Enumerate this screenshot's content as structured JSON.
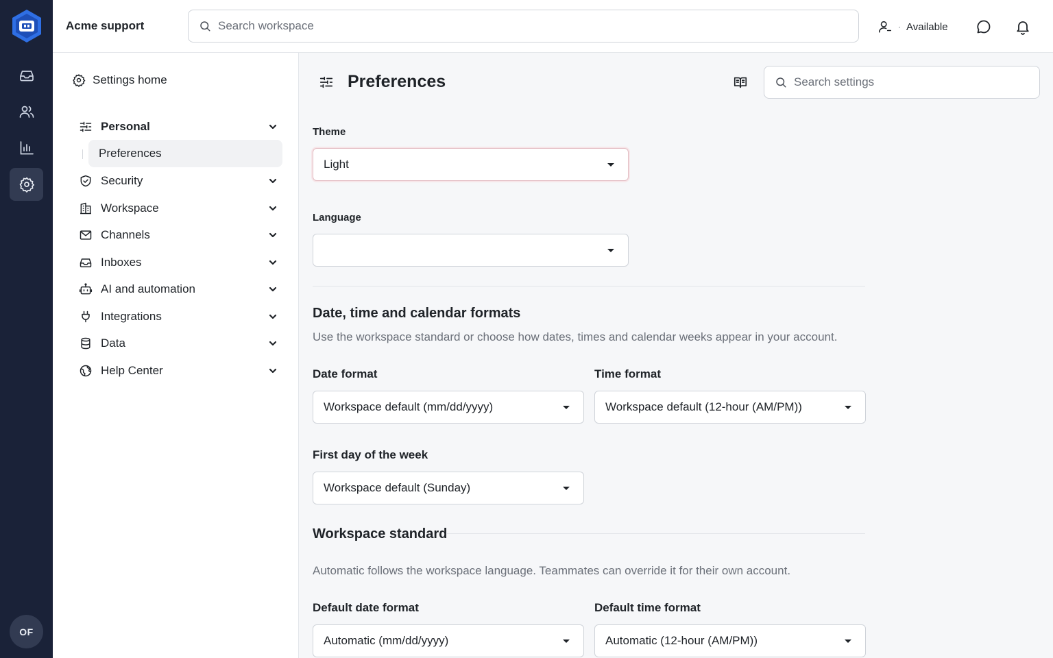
{
  "app": {
    "workspace_name": "Acme support"
  },
  "header": {
    "search_placeholder": "Search workspace",
    "status": "Available",
    "status_dot": "·"
  },
  "rail": {
    "items": [
      {
        "icon": "inbox-icon"
      },
      {
        "icon": "users-icon"
      },
      {
        "icon": "reports-icon"
      },
      {
        "icon": "settings-icon",
        "active": true
      }
    ],
    "avatar_initials": "OF"
  },
  "sidebar": {
    "home_label": "Settings home",
    "items": [
      {
        "label": "Personal",
        "icon": "sliders-icon",
        "expanded": true
      },
      {
        "label": "Security",
        "icon": "shield-icon"
      },
      {
        "label": "Workspace",
        "icon": "building-icon"
      },
      {
        "label": "Channels",
        "icon": "mail-icon"
      },
      {
        "label": "Inboxes",
        "icon": "inbox-icon"
      },
      {
        "label": "AI and automation",
        "icon": "bot-icon"
      },
      {
        "label": "Integrations",
        "icon": "plug-icon"
      },
      {
        "label": "Data",
        "icon": "database-icon"
      },
      {
        "label": "Help Center",
        "icon": "globe-icon"
      }
    ],
    "sub_item": "Preferences"
  },
  "main": {
    "title": "Preferences",
    "search_placeholder": "Search settings",
    "theme": {
      "label": "Theme",
      "value": "Light"
    },
    "language": {
      "label": "Language",
      "value": ""
    },
    "date_section": {
      "title": "Date, time and calendar formats",
      "description": "Use the workspace standard or choose how dates, times and calendar weeks appear in your account."
    },
    "date_format": {
      "label": "Date format",
      "value": "Workspace default (mm/dd/yyyy)"
    },
    "time_format": {
      "label": "Time format",
      "value": "Workspace default (12-hour (AM/PM))"
    },
    "first_day": {
      "label": "First day of the week",
      "value": "Workspace default (Sunday)"
    },
    "workspace_standard": {
      "title": "Workspace standard",
      "description": "Automatic follows the workspace language. Teammates can override it for their own account."
    },
    "default_date_format": {
      "label": "Default date format",
      "value": "Automatic (mm/dd/yyyy)"
    },
    "default_time_format": {
      "label": "Default time format",
      "value": "Automatic (12-hour (AM/PM))"
    }
  },
  "colors": {
    "rail_bg": "#1a2238",
    "rail_active": "#323b52",
    "logo_blue": "#2f6fe4",
    "focus_ring": "#e2bcc2"
  }
}
